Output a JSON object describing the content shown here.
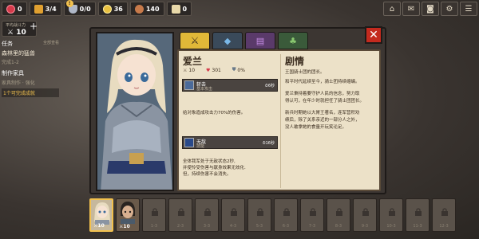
{
  "resources": [
    {
      "icon": "ruby-icon",
      "value": "0"
    },
    {
      "icon": "boot-icon",
      "value": "3/4"
    },
    {
      "icon": "shield-icon",
      "value": "0/0"
    },
    {
      "icon": "coin-icon",
      "value": "36"
    },
    {
      "icon": "meat-icon",
      "value": "140"
    },
    {
      "icon": "cheese-icon",
      "value": "0"
    }
  ],
  "notify_badge": "!",
  "power": {
    "label": "平均战斗力",
    "value": "10"
  },
  "tasks": {
    "header": "任务",
    "view_all": "全部查看",
    "title": "森林里的猛兽",
    "progress": "完成1-2",
    "craft_header": "制作家具",
    "craft_sub": "家具制作 · 强化",
    "reward_line": "1个可完成成就"
  },
  "hero": {
    "name": "爱兰",
    "attack": "10",
    "hp": "301",
    "defense": "0%"
  },
  "skill1": {
    "name": "斩击",
    "type": "基本攻击",
    "cooldown": "6秒",
    "desc": "给对象造成攻击力70%的伤害。"
  },
  "skill2": {
    "name": "无敌",
    "type": "技能",
    "cooldown": "16秒",
    "desc1": "全体我军处于无敌状态2秒,",
    "desc2": "并使怜受伤害与献身效果无效化.",
    "desc3": "但，持续伤害不会消失。"
  },
  "story": {
    "title": "剧情",
    "subtitle": "王国骑士团的团长。",
    "p1a": "和平时代延续至今，骑士团持续缩编。",
    "p2a": "爱兰秉持着要守护人民的信念，努力取",
    "p2b": "得认可，在年少时就担任了骑士团团长。",
    "p3a": "新兵时期她以大胃王著名，连军营积劝",
    "p3b": "绩后，除了关系亲近的一部分人之外，",
    "p3c": "没人敢拿她的食量开玩笑论足。"
  },
  "roster": [
    {
      "type": "hero",
      "level": "10"
    },
    {
      "type": "hero",
      "level": "10"
    },
    {
      "type": "locked",
      "req": "1-3"
    },
    {
      "type": "locked",
      "req": "2-3"
    },
    {
      "type": "locked",
      "req": "3-3"
    },
    {
      "type": "locked",
      "req": "4-3"
    },
    {
      "type": "locked",
      "req": "5-3"
    },
    {
      "type": "locked",
      "req": "6-3"
    },
    {
      "type": "locked",
      "req": "7-3"
    },
    {
      "type": "locked",
      "req": "8-3"
    },
    {
      "type": "locked",
      "req": "9-3"
    },
    {
      "type": "locked",
      "req": "10-3"
    },
    {
      "type": "locked",
      "req": "11-3"
    },
    {
      "type": "locked",
      "req": "12-3"
    }
  ],
  "colors": {
    "accent": "#f2c14e",
    "close": "#c42a1e",
    "parchment": "#ece1c8"
  }
}
